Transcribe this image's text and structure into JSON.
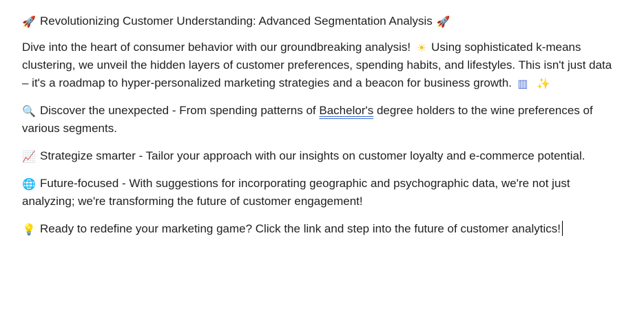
{
  "document": {
    "title": {
      "prefix_icon": "rocket-icon",
      "text": "Revolutionizing Customer Understanding: Advanced Segmentation Analysis",
      "suffix_icon": "rocket-icon"
    },
    "intro": {
      "text_before_sun": "Dive into the heart of consumer behavior with our groundbreaking analysis!",
      "sun_icon": "sun-icon",
      "text_after_sun": "Using sophisticated k-means clustering, we unveil the hidden layers of customer preferences, spending habits, and lifestyles. This isn't just data – it's a roadmap to hyper-personalized marketing strategies and a beacon for business growth.",
      "chart_icon": "bar-chart-icon",
      "sparkle_icon": "sparkles-icon"
    },
    "discover": {
      "icon": "magnifying-glass-icon",
      "text_before": "Discover the unexpected - From spending patterns of",
      "spelling_flagged_word": "Bachelor's",
      "text_after": "degree holders to the wine preferences of various segments."
    },
    "strategize": {
      "icon": "chart-increasing-icon",
      "text": "Strategize smarter - Tailor your approach with our insights on customer loyalty and e-commerce potential."
    },
    "future": {
      "icon": "globe-icon",
      "text": "Future-focused - With suggestions for incorporating geographic and psychographic data, we're not just analyzing; we're transforming the future of customer engagement!"
    },
    "cta": {
      "icon": "light-bulb-icon",
      "text": "Ready to redefine your marketing game? Click the link and step into the future of customer analytics!"
    }
  },
  "colors": {
    "text": "#1f1f1f",
    "spellcheck_underline": "#3b68c9",
    "caret": "#000000"
  }
}
